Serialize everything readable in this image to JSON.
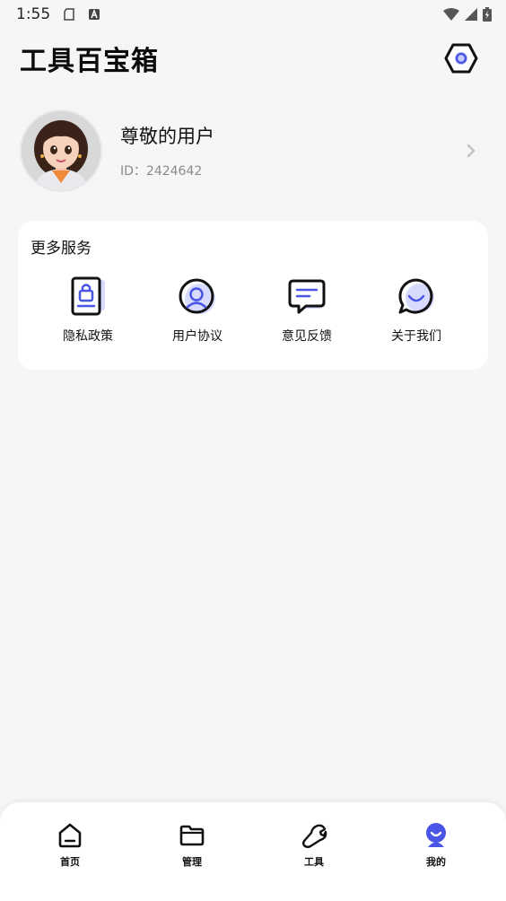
{
  "status_bar": {
    "time": "1:55",
    "icons": [
      "sd-card-icon",
      "a-badge-icon",
      "wifi-icon",
      "signal-icon",
      "battery-charging-icon"
    ]
  },
  "header": {
    "title": "工具百宝箱",
    "settings_icon": "settings-hexagon-icon"
  },
  "profile": {
    "name": "尊敬的用户",
    "id_text": "ID：2424642"
  },
  "services": {
    "title": "更多服务",
    "items": [
      {
        "label": "隐私政策",
        "icon": "privacy-lock-icon"
      },
      {
        "label": "用户协议",
        "icon": "user-agreement-icon"
      },
      {
        "label": "意见反馈",
        "icon": "feedback-icon"
      },
      {
        "label": "关于我们",
        "icon": "about-chat-icon"
      }
    ]
  },
  "nav": {
    "items": [
      {
        "label": "首页",
        "icon": "home-icon",
        "active": false
      },
      {
        "label": "管理",
        "icon": "folder-icon",
        "active": false
      },
      {
        "label": "工具",
        "icon": "wrench-icon",
        "active": false
      },
      {
        "label": "我的",
        "icon": "profile-icon",
        "active": true
      }
    ]
  },
  "colors": {
    "accent": "#4a55e6",
    "accent_light": "#d7dcff",
    "background": "#f6f6f6",
    "card": "#ffffff"
  }
}
